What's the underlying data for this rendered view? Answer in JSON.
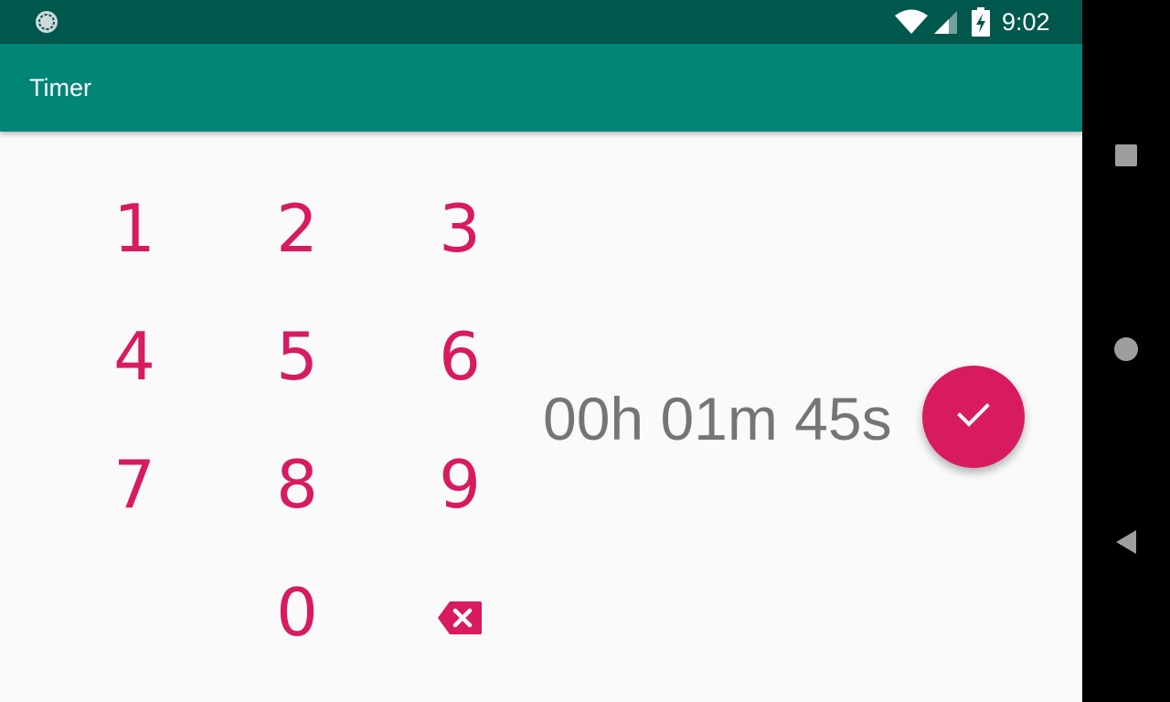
{
  "status_bar": {
    "time": "9:02",
    "icons": [
      "notification-icon",
      "wifi-icon",
      "signal-icon",
      "battery-charging-icon"
    ]
  },
  "app_bar": {
    "title": "Timer"
  },
  "keypad": {
    "keys": [
      "1",
      "2",
      "3",
      "4",
      "5",
      "6",
      "7",
      "8",
      "9",
      "0"
    ],
    "backspace_icon": "backspace-icon"
  },
  "timer": {
    "display": "00h 01m 45s"
  },
  "fab": {
    "icon": "check-icon"
  },
  "nav_bar": {
    "buttons": [
      "recents-icon",
      "home-icon",
      "back-icon"
    ]
  },
  "colors": {
    "status_bar": "#00574b",
    "app_bar": "#008577",
    "accent": "#d81b60",
    "display_text": "#757575",
    "background": "#fafafa"
  }
}
